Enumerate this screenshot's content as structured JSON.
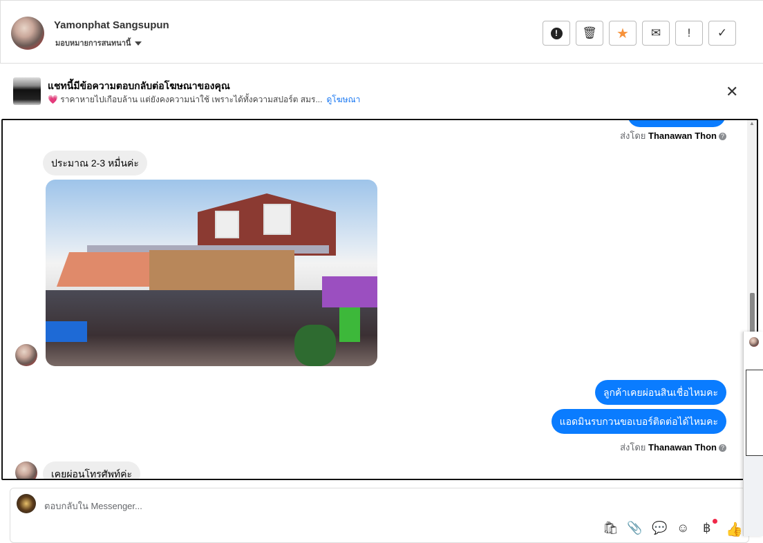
{
  "header": {
    "name": "Yamonphat Sangsupun",
    "assign_label": "มอบหมายการสนทนานี้",
    "actions": [
      {
        "name": "report",
        "glyph": "❗"
      },
      {
        "name": "delete",
        "glyph": "🗑"
      },
      {
        "name": "star",
        "glyph": "★"
      },
      {
        "name": "mark-unread",
        "glyph": "✉"
      },
      {
        "name": "spam",
        "glyph": "!"
      },
      {
        "name": "done",
        "glyph": "✓"
      }
    ]
  },
  "ad": {
    "title": "แชทนี้มีข้อความตอบกลับต่อโฆษณาของคุณ",
    "heart": "💗",
    "text": "ราคาหายไปเกือบล้าน แต่ยังคงความน่าใช้ เพราะได้ทั้งความสปอร์ต สมร...",
    "link": "ดูโฆษณา",
    "close": "✕"
  },
  "messages": {
    "sent_by_prefix": "ส่งโดย",
    "sender": "Thanawan Thon",
    "help": "?",
    "m1": "ประมาณ 2-3 หมื่นค่ะ",
    "m2": "ลูกค้าเคยผ่อนสินเชื่อไหมคะ",
    "m3": "แอดมินรบกวนขอเบอร์ติดต่อได้ไหมคะ",
    "m4": "เคยผ่อนโทรศัพท์ค่ะ"
  },
  "composer": {
    "placeholder": "ตอบกลับใน Messenger...",
    "icons": [
      "🛍",
      "📎",
      "💬",
      "☺",
      "฿",
      "👍"
    ]
  },
  "colors": {
    "accent": "#0a7cff",
    "star": "#f7923a"
  }
}
